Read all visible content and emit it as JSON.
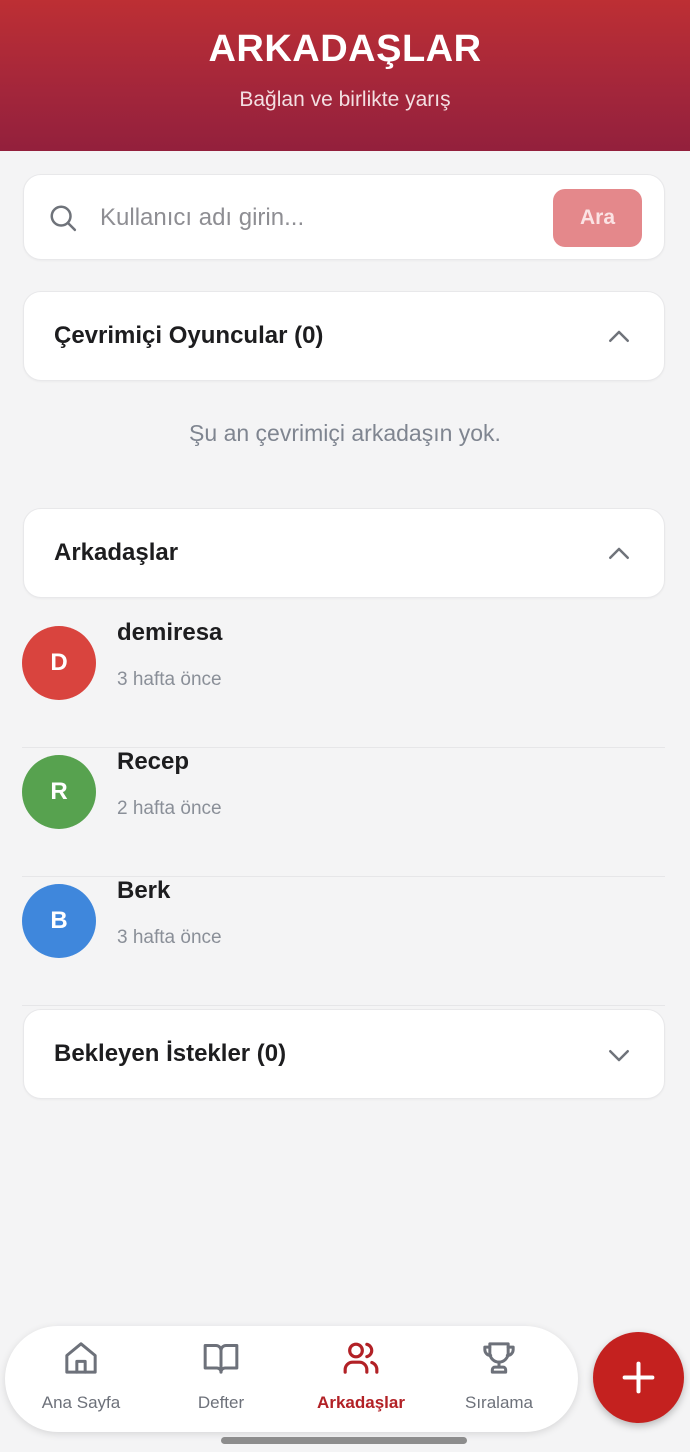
{
  "header": {
    "title": "ARKADAŞLAR",
    "subtitle": "Bağlan ve birlikte yarış"
  },
  "search": {
    "placeholder": "Kullanıcı adı girin...",
    "value": "",
    "button_label": "Ara"
  },
  "online_section": {
    "title": "Çevrimiçi Oyuncular (0)",
    "expanded": true,
    "empty_message": "Şu an çevrimiçi arkadaşın yok."
  },
  "friends_section": {
    "title": "Arkadaşlar",
    "expanded": true,
    "items": [
      {
        "initial": "D",
        "name": "demiresa",
        "last_seen": "3 hafta önce",
        "color": "#d9443e"
      },
      {
        "initial": "R",
        "name": "Recep",
        "last_seen": "2 hafta önce",
        "color": "#57a24f"
      },
      {
        "initial": "B",
        "name": "Berk",
        "last_seen": "3 hafta önce",
        "color": "#3f87dc"
      }
    ]
  },
  "pending_section": {
    "title": "Bekleyen İstekler (0)",
    "expanded": false
  },
  "bottom_nav": {
    "items": [
      {
        "label": "Ana Sayfa",
        "icon": "home-icon",
        "active": false
      },
      {
        "label": "Defter",
        "icon": "book-icon",
        "active": false
      },
      {
        "label": "Arkadaşlar",
        "icon": "users-icon",
        "active": true
      },
      {
        "label": "Sıralama",
        "icon": "trophy-icon",
        "active": false
      }
    ]
  },
  "fab": {
    "icon": "plus-icon"
  },
  "colors": {
    "accent": "#b22126",
    "header_gradient_top": "#bd2f34",
    "header_gradient_bottom": "#93203c",
    "search_button": "#e4888b"
  }
}
